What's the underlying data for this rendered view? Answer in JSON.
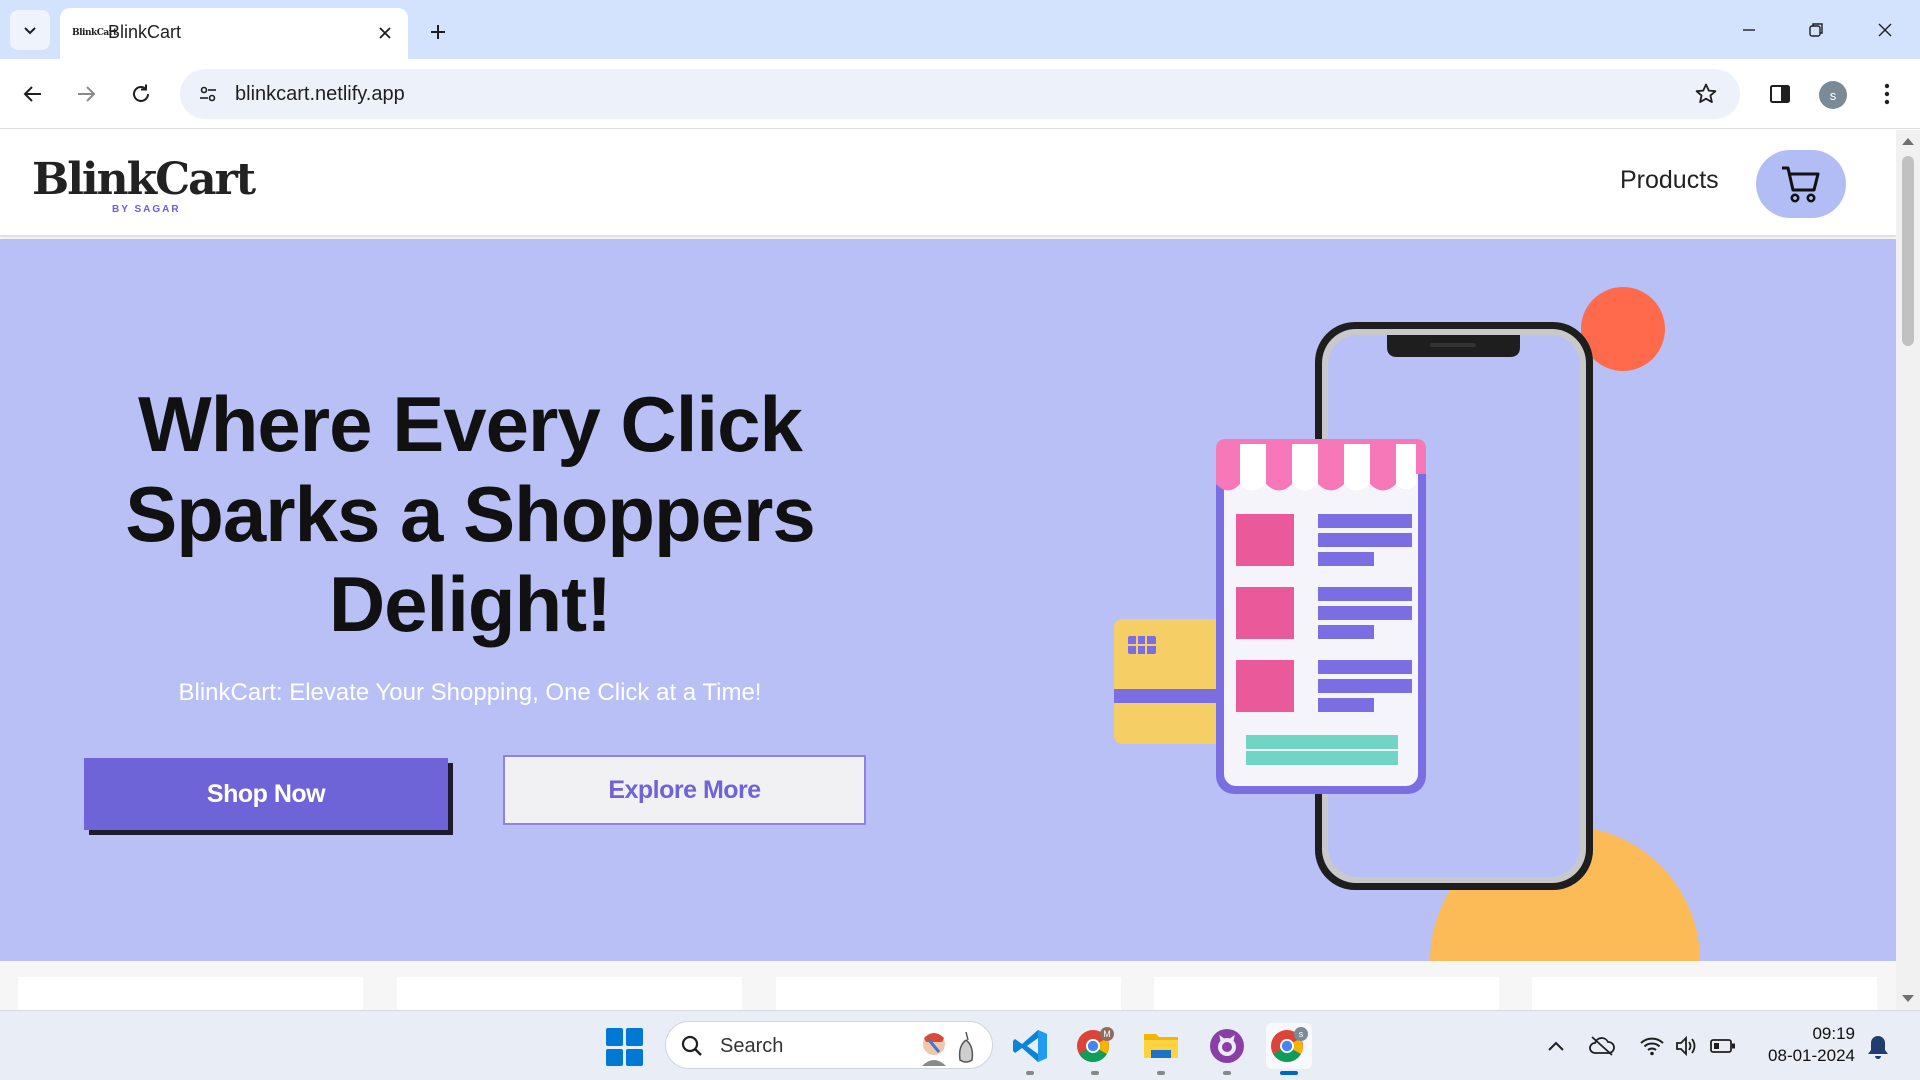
{
  "browser": {
    "tab_title": "BlinkCart",
    "tab_favicon_text": "BlinkCart",
    "url": "blinkcart.netlify.app",
    "profile_initial": "s"
  },
  "site": {
    "logo_text": "BlinkCart",
    "logo_sub": "BY SAGAR",
    "nav_products": "Products",
    "colors": {
      "hero_bg": "#b8c0f5",
      "primary": "#6f63d8",
      "cart_btn_bg": "#b3bdf5"
    }
  },
  "hero": {
    "title": "Where Every Click Sparks a Shoppers Delight!",
    "subtitle": "BlinkCart: Elevate Your Shopping, One Click at a Time!",
    "shop_now": "Shop Now",
    "explore_more": "Explore More"
  },
  "taskbar": {
    "search_placeholder": "Search",
    "apps": [
      "windows-start",
      "vscode",
      "chrome-profile-m",
      "file-explorer",
      "github-desktop",
      "chrome-profile-s"
    ],
    "time": "09:19",
    "date": "08-01-2024"
  }
}
